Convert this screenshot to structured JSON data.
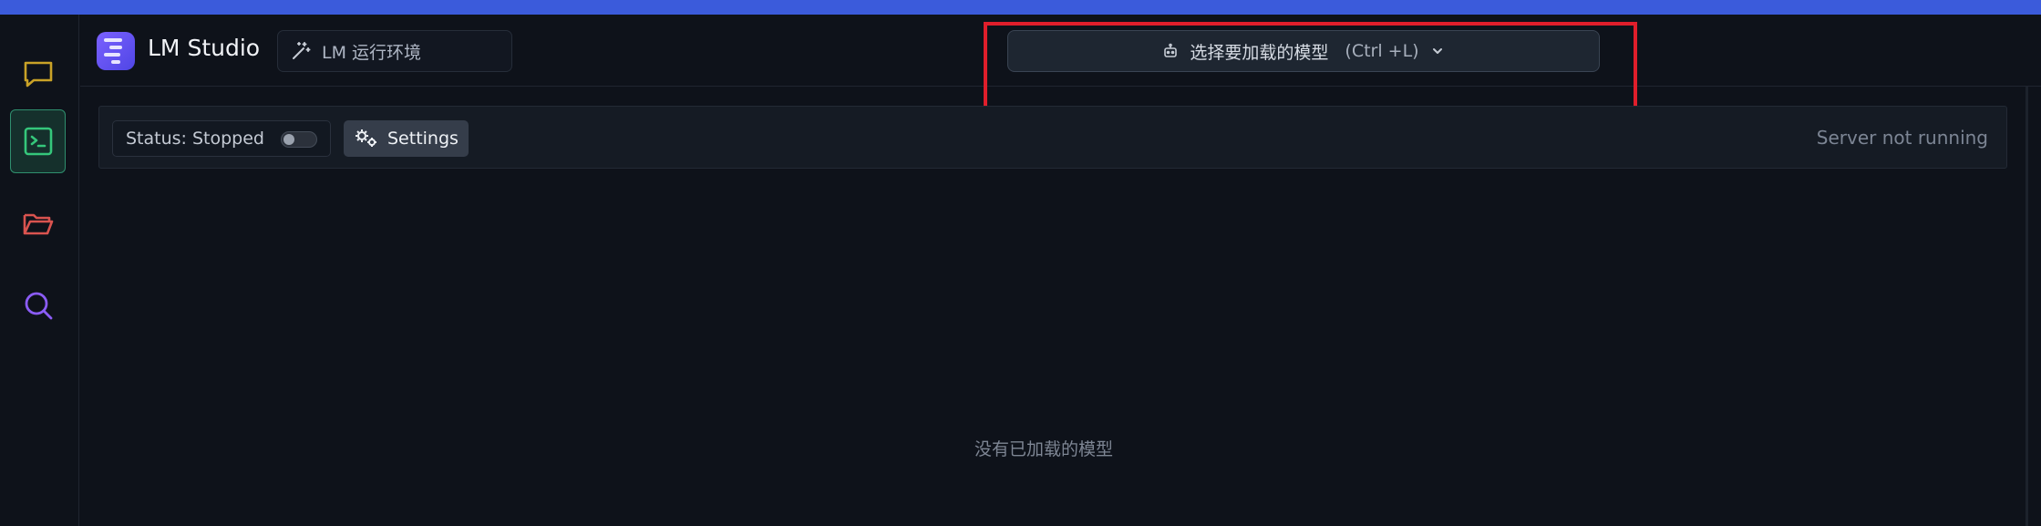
{
  "app": {
    "title": "LM Studio",
    "runtime_button": "LM 运行环境"
  },
  "model_selector": {
    "label": "选择要加载的模型",
    "shortcut": "(Ctrl +L)"
  },
  "toolbar": {
    "status_label": "Status: Stopped",
    "server_toggle_on": false,
    "settings_label": "Settings",
    "server_status": "Server not running"
  },
  "main": {
    "empty_message": "没有已加载的模型"
  },
  "rail": {
    "items": [
      {
        "icon": "chat-icon",
        "color": "#c9a227",
        "active": false
      },
      {
        "icon": "terminal-icon",
        "color": "#35c77b",
        "active": true
      },
      {
        "icon": "folder-icon",
        "color": "#d9534f",
        "active": false
      },
      {
        "icon": "search-icon",
        "color": "#8b5cf6",
        "active": false
      }
    ]
  },
  "colors": {
    "accent_strip": "#3b5bdb",
    "highlight": "#e01e2b",
    "background": "#0e121a"
  }
}
